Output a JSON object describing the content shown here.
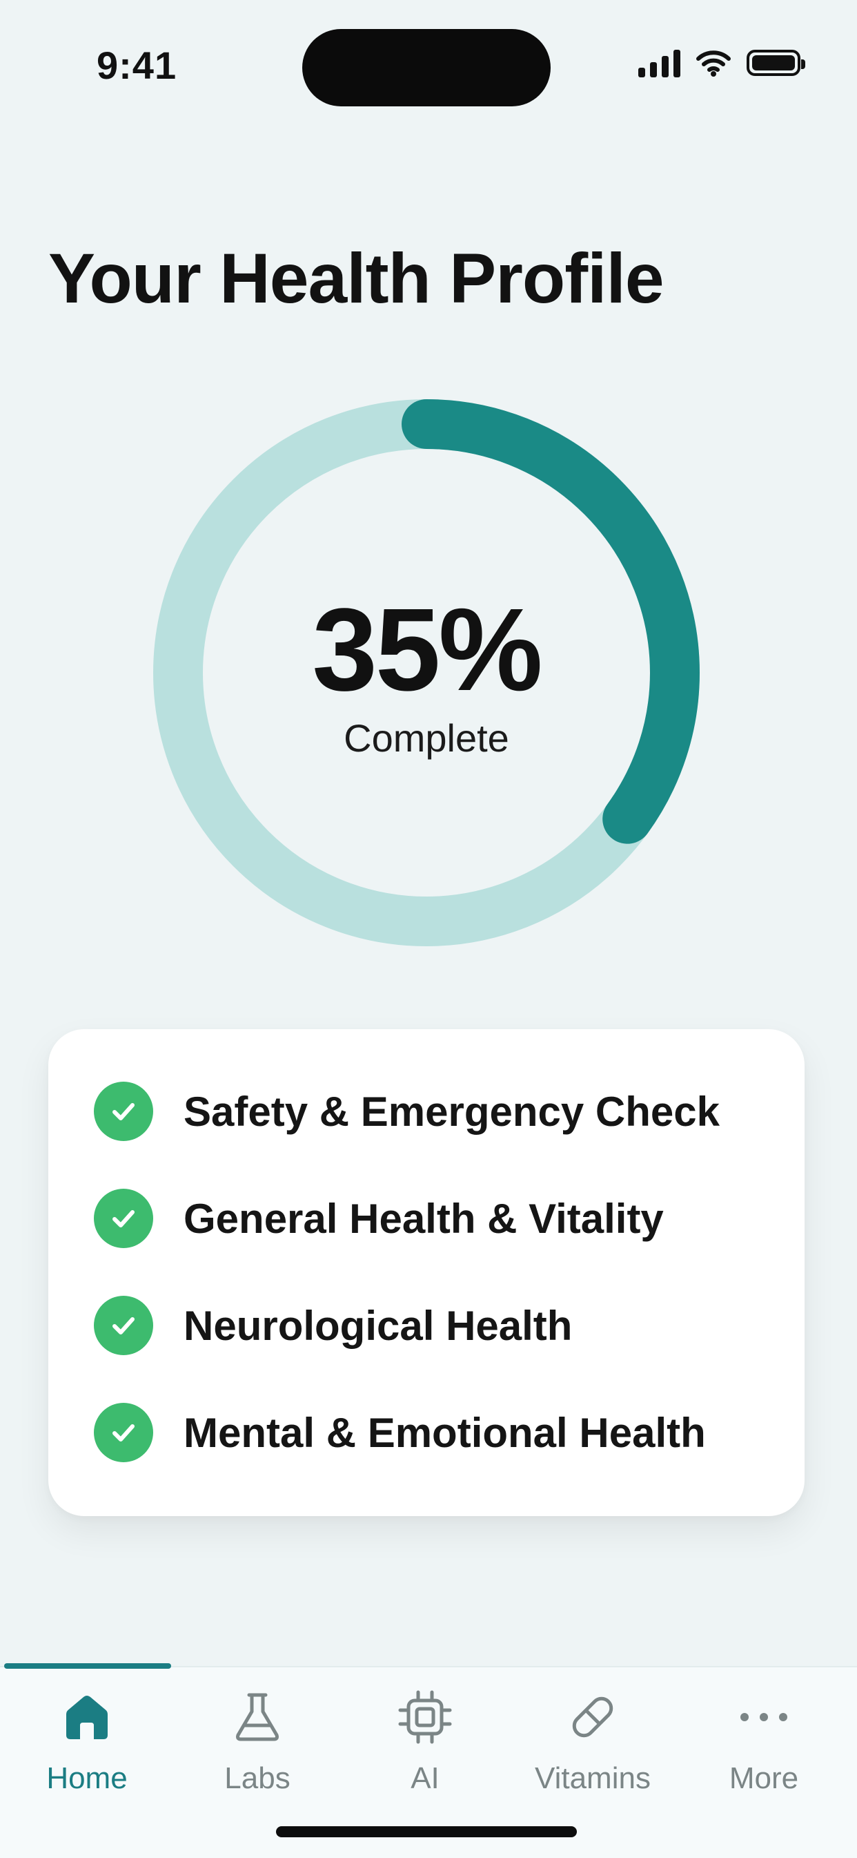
{
  "status_bar": {
    "time": "9:41"
  },
  "header": {
    "title": "Your Health Profile"
  },
  "progress": {
    "value_label": "35%",
    "caption": "Complete",
    "fraction": 0.35,
    "track_color": "#b9e0de",
    "fill_color": "#1a8a86"
  },
  "checklist": {
    "check_color": "#3dbb6e",
    "items": [
      {
        "label": "Safety & Emergency Check",
        "checked": true
      },
      {
        "label": "General Health & Vitality",
        "checked": true
      },
      {
        "label": "Neurological Health",
        "checked": true
      },
      {
        "label": "Mental & Emotional Health",
        "checked": true
      }
    ]
  },
  "tab_bar": {
    "active_color": "#1b7d83",
    "tabs": [
      {
        "label": "Home",
        "icon": "home-icon",
        "active": true
      },
      {
        "label": "Labs",
        "icon": "flask-icon",
        "active": false
      },
      {
        "label": "AI",
        "icon": "chip-icon",
        "active": false
      },
      {
        "label": "Vitamins",
        "icon": "pill-icon",
        "active": false
      },
      {
        "label": "More",
        "icon": "more-dots-icon",
        "active": false
      }
    ]
  }
}
